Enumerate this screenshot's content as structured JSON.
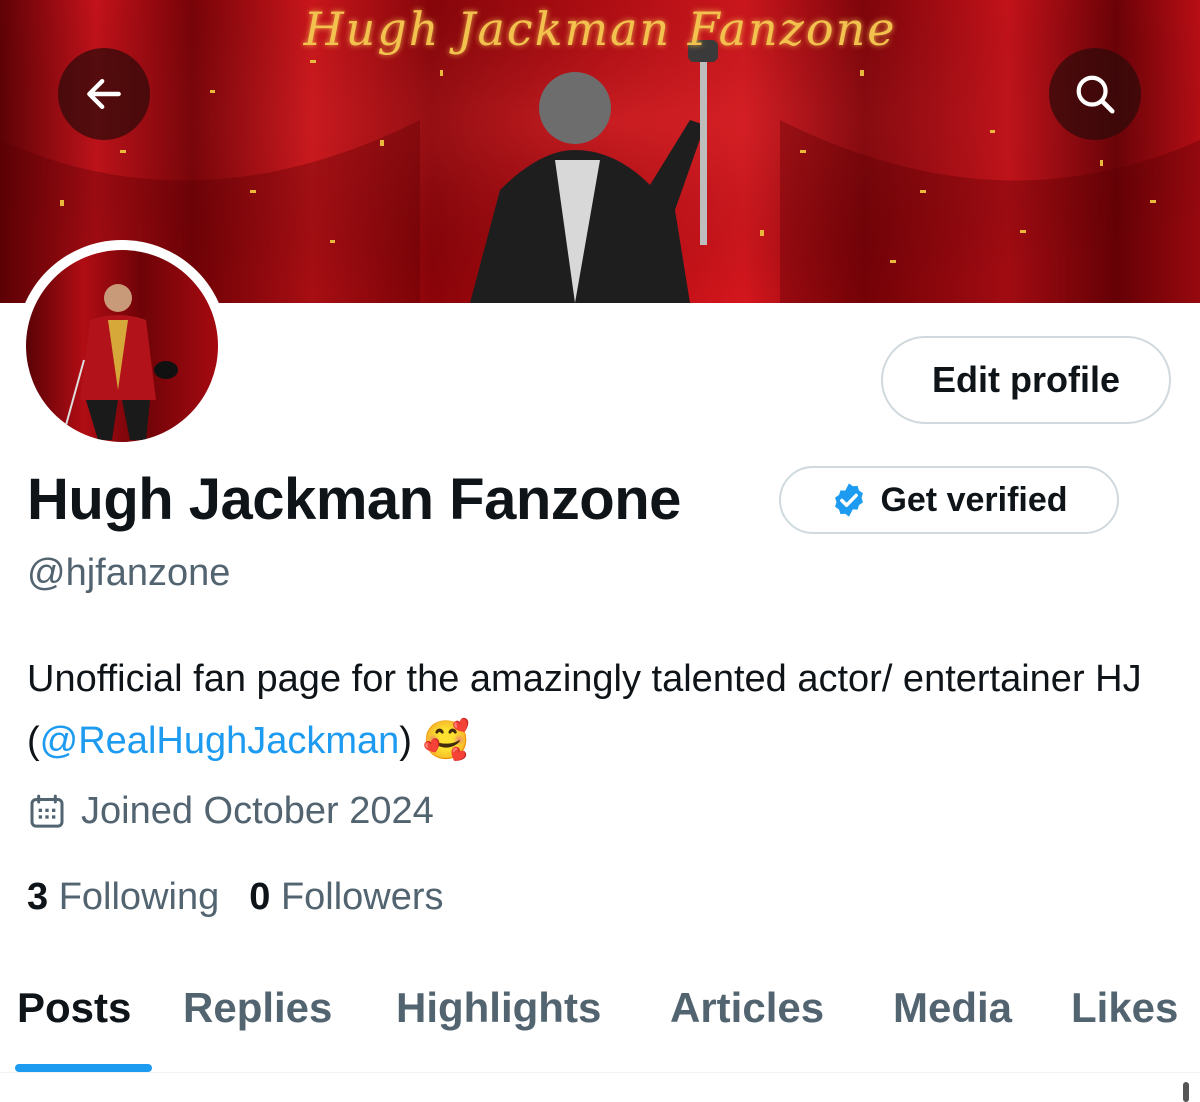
{
  "banner": {
    "title": "Hugh Jackman Fanzone"
  },
  "header": {
    "back_icon": "arrow-left-icon",
    "search_icon": "search-icon"
  },
  "profile": {
    "display_name": "Hugh Jackman Fanzone",
    "handle": "@hjfanzone",
    "edit_label": "Edit profile",
    "verify_label": "Get verified",
    "verify_icon": "verified-badge-icon",
    "bio_text": "Unofficial fan page for the amazingly talented actor/ entertainer HJ (",
    "bio_mention": "@RealHughJackman",
    "bio_suffix": ")",
    "bio_emoji": "🥰",
    "joined_icon": "calendar-icon",
    "joined": "Joined October 2024",
    "following_count": "3",
    "following_label": "Following",
    "followers_count": "0",
    "followers_label": "Followers"
  },
  "tabs": [
    {
      "label": "Posts",
      "active": true
    },
    {
      "label": "Replies",
      "active": false
    },
    {
      "label": "Highlights",
      "active": false
    },
    {
      "label": "Articles",
      "active": false
    },
    {
      "label": "Media",
      "active": false
    },
    {
      "label": "Likes",
      "active": false
    }
  ],
  "colors": {
    "accent": "#1d9bf0",
    "text_primary": "#0f1419",
    "text_secondary": "#536471",
    "border": "#cfd9de",
    "banner_red": "#a4060b"
  }
}
